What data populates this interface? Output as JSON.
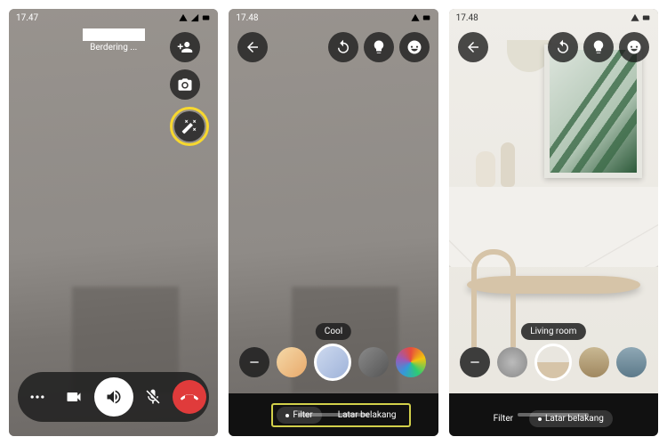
{
  "screen1": {
    "time": "17.47",
    "status_text": "Berdering ..."
  },
  "screen2": {
    "time": "17.48",
    "filter_label": "Cool",
    "tabs": {
      "filter": "Filter",
      "background": "Latar belakang"
    }
  },
  "screen3": {
    "time": "17.48",
    "bg_label": "Living room",
    "tabs": {
      "filter": "Filter",
      "background": "Latar belakang"
    }
  }
}
